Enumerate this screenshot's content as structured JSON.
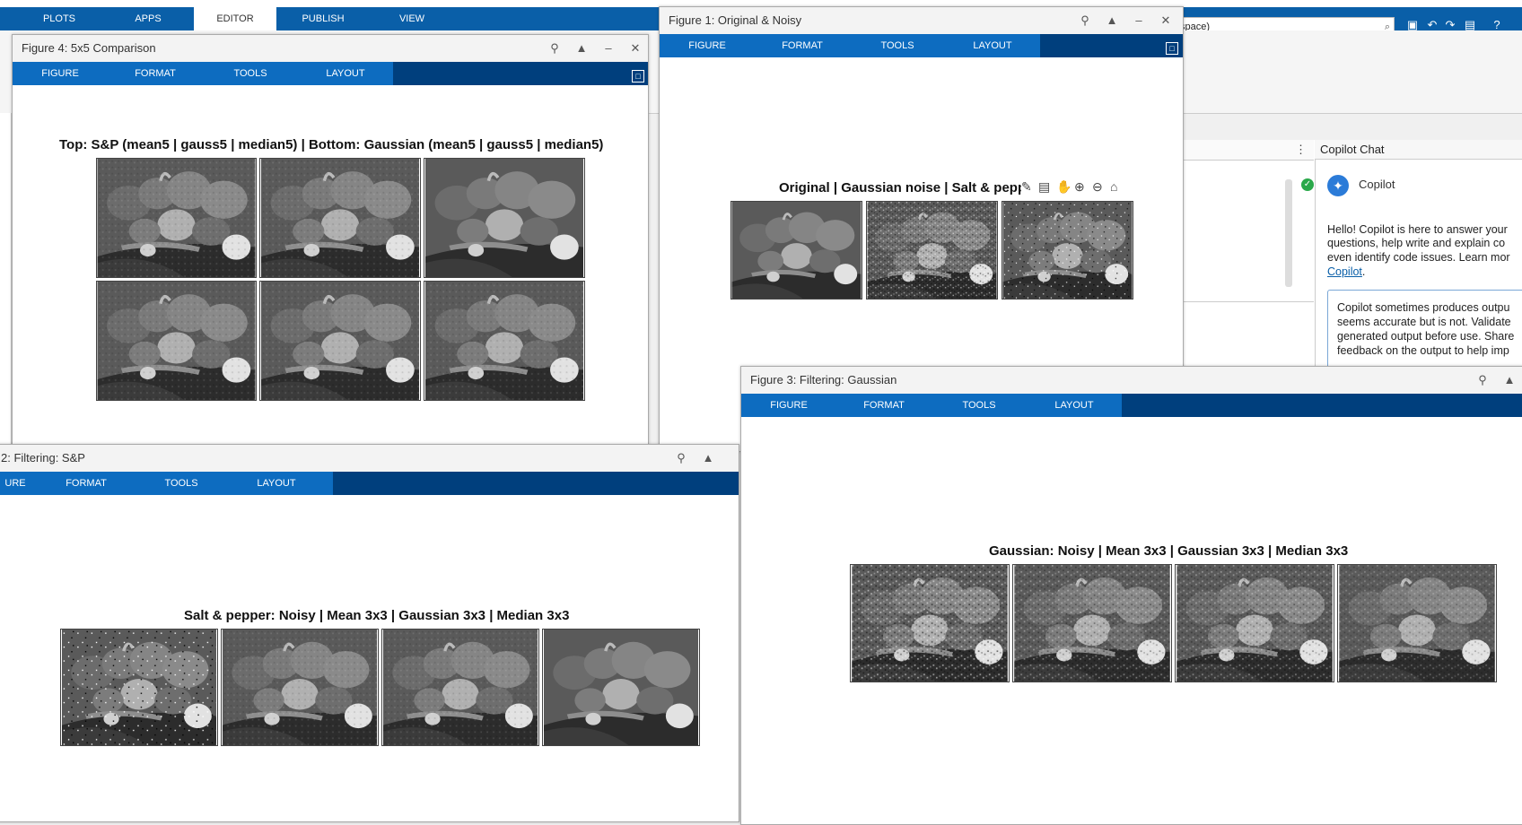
{
  "main": {
    "tabs": [
      "PLOTS",
      "APPS",
      "EDITOR",
      "PUBLISH",
      "VIEW"
    ],
    "active_tab": "EDITOR",
    "search_value": "space)"
  },
  "copilot": {
    "panel_title": "Copilot Chat",
    "name": "Copilot",
    "greeting_lines": [
      "Hello! Copilot is here to answer your",
      "questions, help write and explain co",
      "even identify code issues. Learn mor"
    ],
    "link": "Copilot",
    "link_suffix": ".",
    "notice_lines": [
      "Copilot sometimes produces outpu",
      "seems accurate but is not. Validate",
      "generated output before use. Share",
      "feedback on the output to help imp"
    ]
  },
  "figure_tabs": [
    "FIGURE",
    "FORMAT",
    "TOOLS",
    "LAYOUT"
  ],
  "fig4": {
    "title": "Figure 4: 5x5 Comparison",
    "plot_title": "Top: S&P (mean5 | gauss5 | median5)  |  Bottom: Gaussian (mean5 | gauss5 | median5)"
  },
  "fig1": {
    "title": "Figure 1: Original & Noisy",
    "plot_title": "Original | Gaussian noise | Salt & pepp"
  },
  "fig2": {
    "title": "2: Filtering: S&P",
    "first_tab": "URE",
    "plot_title": "Salt & pepper: Noisy | Mean 3x3 | Gaussian 3x3 | Median 3x3"
  },
  "fig3": {
    "title": "Figure 3: Filtering: Gaussian",
    "plot_title": "Gaussian: Noisy | Mean 3x3 | Gaussian 3x3 | Median 3x3"
  },
  "colors": {
    "tab_blue": "#0d6cc0",
    "bar_dark": "#003f7d",
    "main_blue": "#0a5fa8"
  }
}
